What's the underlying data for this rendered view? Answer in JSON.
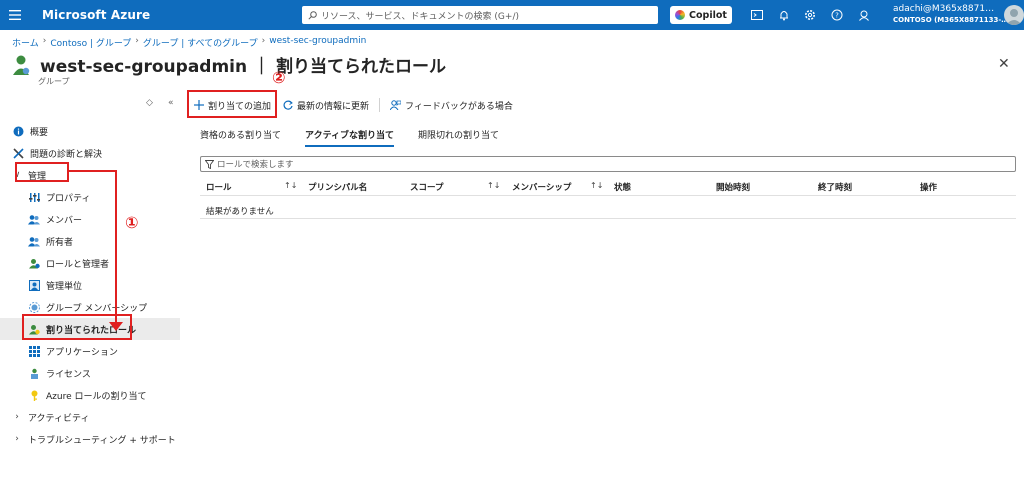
{
  "topbar": {
    "brand": "Microsoft Azure",
    "search_placeholder": "リソース、サービス、ドキュメントの検索 (G+/)",
    "copilot_label": "Copilot",
    "account_name": "adachi@M365x8871…",
    "account_tenant": "CONTOSO (M365X8871133-…",
    "accent_color": "#0f6cbd"
  },
  "breadcrumb": [
    "ホーム",
    "Contoso | グループ",
    "グループ | すべてのグループ",
    "west-sec-groupadmin"
  ],
  "page": {
    "title": "west-sec-groupadmin ｜ 割り当てられたロール",
    "subtitle": "グループ",
    "more": "···",
    "close": "✕"
  },
  "nav": {
    "items": [
      {
        "label": "概要",
        "icon": "info-icon"
      },
      {
        "label": "問題の診断と解決",
        "icon": "wrench-icon"
      },
      {
        "label": "管理",
        "icon": "chevron-down-icon"
      },
      {
        "label": "プロパティ",
        "icon": "properties-icon"
      },
      {
        "label": "メンバー",
        "icon": "members-icon"
      },
      {
        "label": "所有者",
        "icon": "owners-icon"
      },
      {
        "label": "ロールと管理者",
        "icon": "roles-admin-icon"
      },
      {
        "label": "管理単位",
        "icon": "admin-units-icon"
      },
      {
        "label": "グループ メンバーシップ",
        "icon": "group-membership-icon"
      },
      {
        "label": "割り当てられたロール",
        "icon": "assigned-roles-icon"
      },
      {
        "label": "アプリケーション",
        "icon": "applications-icon"
      },
      {
        "label": "ライセンス",
        "icon": "licenses-icon"
      },
      {
        "label": "Azure ロールの割り当て",
        "icon": "key-icon"
      },
      {
        "label": "アクティビティ",
        "icon": "chevron-right-icon"
      },
      {
        "label": "トラブルシューティング + サポート",
        "icon": "chevron-right-icon"
      }
    ]
  },
  "toolbar": {
    "add_label": "割り当ての追加",
    "refresh_label": "最新の情報に更新",
    "feedback_label": "フィードバックがある場合"
  },
  "tabs": [
    "資格のある割り当て",
    "アクティブな割り当て",
    "期限切れの割り当て"
  ],
  "filter_placeholder": "ロールで検索します",
  "table": {
    "columns": [
      "ロール",
      "プリンシパル名",
      "スコープ",
      "メンバーシップ",
      "状態",
      "開始時刻",
      "終了時刻",
      "操作"
    ],
    "sort_glyph": "↑↓",
    "empty_text": "結果がありません"
  },
  "annotations": {
    "marker_1": "①",
    "marker_2": "②",
    "color": "#e02020"
  }
}
